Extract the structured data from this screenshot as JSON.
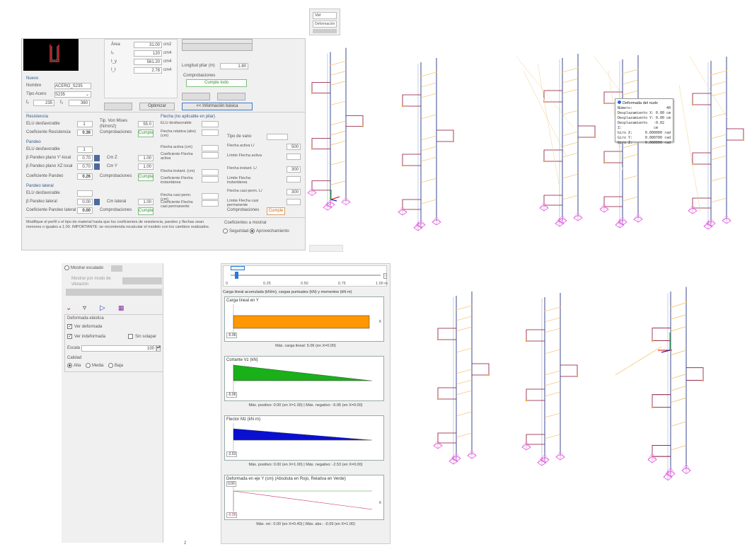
{
  "top_left_panel": {
    "section_title": "Nuevo",
    "nombre_label": "Nombre",
    "nombre_value": "ACERO_S235",
    "tipo_acero_label": "Tipo Acero",
    "tipo_acero_value": "S235",
    "fy_label": "fₓ",
    "fy_value": "235",
    "fu_label": "fᵤ",
    "fu_value": "360",
    "props": [
      {
        "label": "Área",
        "value": "31.00",
        "unit": "cm2"
      },
      {
        "label": "Iₓ",
        "value": "120",
        "unit": "cm4"
      },
      {
        "label": "I_y",
        "value": "561.20",
        "unit": "cm4"
      },
      {
        "label": "I_t",
        "value": "2.78",
        "unit": "cm4"
      }
    ],
    "longitud_label": "Longitud pilar (m)",
    "longitud_value": "1.80",
    "comprobaciones_label": "Comprobaciones",
    "cumple_todo_label": "Cumple todo",
    "optimizar_label": "Optimizar",
    "info_label": "<< Información básica",
    "resistencia": {
      "title": "Resistencia",
      "elu_label": "ELU desfavorable",
      "elu_value": "1",
      "coef_label": "Coeficiente Resistencia",
      "coef_value": "0.36",
      "tipo_label": "Tip. Von Mises (N/mm2)",
      "tipo_value": "55.0",
      "comp_label": "Comprobaciones",
      "comp_value": "Cumple"
    },
    "pandeo": {
      "title": "Pandeo",
      "elu_label": "ELU desfavorable",
      "elu_value": "1",
      "bp_y_label": "β Pandeo plano Y'-local",
      "bp_y_value": "0.70",
      "bp_z_label": "β Pandeo plano XZ local",
      "bp_z_value": "0.70",
      "cmz_label": "Cm Z",
      "cmz_value": "1.00",
      "cmy_label": "Cm Y",
      "cmy_value": "1.00",
      "coef_label": "Coeficiente Pandeo",
      "coef_value": "0.26",
      "comp_label": "Comprobaciones",
      "comp_value": "Cumple"
    },
    "pandeo_lateral": {
      "title": "Pandeo lateral",
      "elu_label": "ELU desfavorable",
      "elu_value": "",
      "bp_label": "β Pandeo lateral",
      "bp_value": "0.00",
      "cm_label": "Cm lateral",
      "cm_value": "1.00",
      "coef_label": "Coeficiente Pandeo lateral",
      "coef_value": "0.00",
      "comp_label": "Comprobaciones",
      "comp_value": "Cumple"
    },
    "flecha": {
      "title": "Flecha (no aplicable en pilar)",
      "rows": [
        {
          "label": "ELU desfavorable"
        },
        {
          "label": "Flecha relativa (abs) (cm)"
        },
        {
          "label": "Flecha activa (cm)"
        },
        {
          "label": "Coeficiente Flecha activa"
        },
        {
          "label": "Flecha instant. (cm)"
        },
        {
          "label": "Coeficiente Flecha instantánea"
        },
        {
          "label": "Flecha casi perm. (cm)"
        },
        {
          "label": "Coeficiente Flecha casi permanente"
        }
      ],
      "tipo_vano_label": "Tipo de vano",
      "right_rows": [
        {
          "label": "Flecha activa L/",
          "value": "500"
        },
        {
          "label": "Límite Flecha activa",
          "value": ""
        },
        {
          "label": "Flecha instant. L/",
          "value": "300"
        },
        {
          "label": "Límite Flecha instantánea",
          "value": ""
        },
        {
          "label": "Flecha casi perm. L/",
          "value": "300"
        },
        {
          "label": "Límite Flecha casi permanente",
          "value": ""
        }
      ],
      "comp_label": "Comprobaciones",
      "comp_value": "Cumple"
    },
    "note": "Modifique el perfil o el tipo de material hasta que los coeficientes de resistencia, pandeo y flechas sean menores o iguales a 1.00. IMPORTANTE: se recomienda recalcular el modelo con los cambios realizados.",
    "coef_mostrar_label": "Coeficientes a mostrar",
    "seguridad_label": "Seguridad",
    "aprovechamiento_label": "Aprovechamiento"
  },
  "top_mini_panel": {
    "item1": "Ver",
    "item2": "Deformación"
  },
  "tooltip": {
    "title": "Deformada del nudo",
    "rows": [
      {
        "k": "Número:",
        "v": "40"
      },
      {
        "k": "Desplazamiento X:",
        "v": "0.00 cm"
      },
      {
        "k": "Desplazamiento Y:",
        "v": "0.00 cm"
      },
      {
        "k": "Desplazamiento Z:",
        "v": "-0.02 cm"
      },
      {
        "k": "Giro X:",
        "v": "0.000000 rad"
      },
      {
        "k": "Giro Y:",
        "v": "0.000700 rad"
      },
      {
        "k": "Giro Z:",
        "v": "0.000000 rad"
      }
    ]
  },
  "bottom_left_panel": {
    "mostrar_escalado_label": "Mostrar escalado",
    "mostrar_modo_label": "Mostrar por modo de vibración",
    "deformada_group": "Deformada elástica",
    "ver_deformada_label": "Ver deformada",
    "ver_indeformada_label": "Ver indeformada",
    "sin_solapar_label": "Sin solapar",
    "escala_label": "Escala",
    "escala_value": "100",
    "calidad_label": "Calidad",
    "calidad_options": [
      "Alta",
      "Media",
      "Baja"
    ]
  },
  "diagram_panel": {
    "slider_ticks": [
      "0",
      "0.25",
      "0.50",
      "0.75",
      "1.00 m"
    ],
    "header": "Carga lineal acumulada (kN/m), cargas puntuales (kN) y momentos (kN·m)",
    "charts": [
      {
        "title": "Carga lineal en Y",
        "axis_value": "-5.06",
        "end_label": "X",
        "caption": "Máx. carga lineal: 5.06 (en X=0.00)",
        "color": "#ff9800"
      },
      {
        "title": "Cortante Vz (kN)",
        "axis_value": "-5.06",
        "end_label": "",
        "caption": "Máx. positivo: 0.00 (en X=1.00)  |  Máx. negativo: -5.06 (en X=0.00)",
        "color": "#1ab01a"
      },
      {
        "title": "Flector Mz (kN·m)",
        "axis_value": "-2.53",
        "end_label": "",
        "caption": "Máx. positivo: 0.00 (en X=1.00)  |  Máx. negativo: -2.53 (en X=0.00)",
        "color": "#0a10d0"
      },
      {
        "title": "Deformada en eje Y (cm) (Absoluta en Rojo, Relativa en Verde)",
        "axis_value": "0.00",
        "axis_value_bottom": "-0.09",
        "end_label": "X",
        "caption": "Máx. rel.: 0.00 (en X=0.40)  |  Máx. abs.: -0.09 (en X=1.00)",
        "color": "#c03070"
      }
    ]
  },
  "page_number": "2",
  "colors": {
    "bar_orange": "#ff9800",
    "shear_green": "#1ab01a",
    "moment_blue": "#0a10d0",
    "column_blue": "#3b4a8f",
    "beam_orange": "#f0b040",
    "brace_red": "#8a1030",
    "support_magenta": "#e060e0"
  }
}
